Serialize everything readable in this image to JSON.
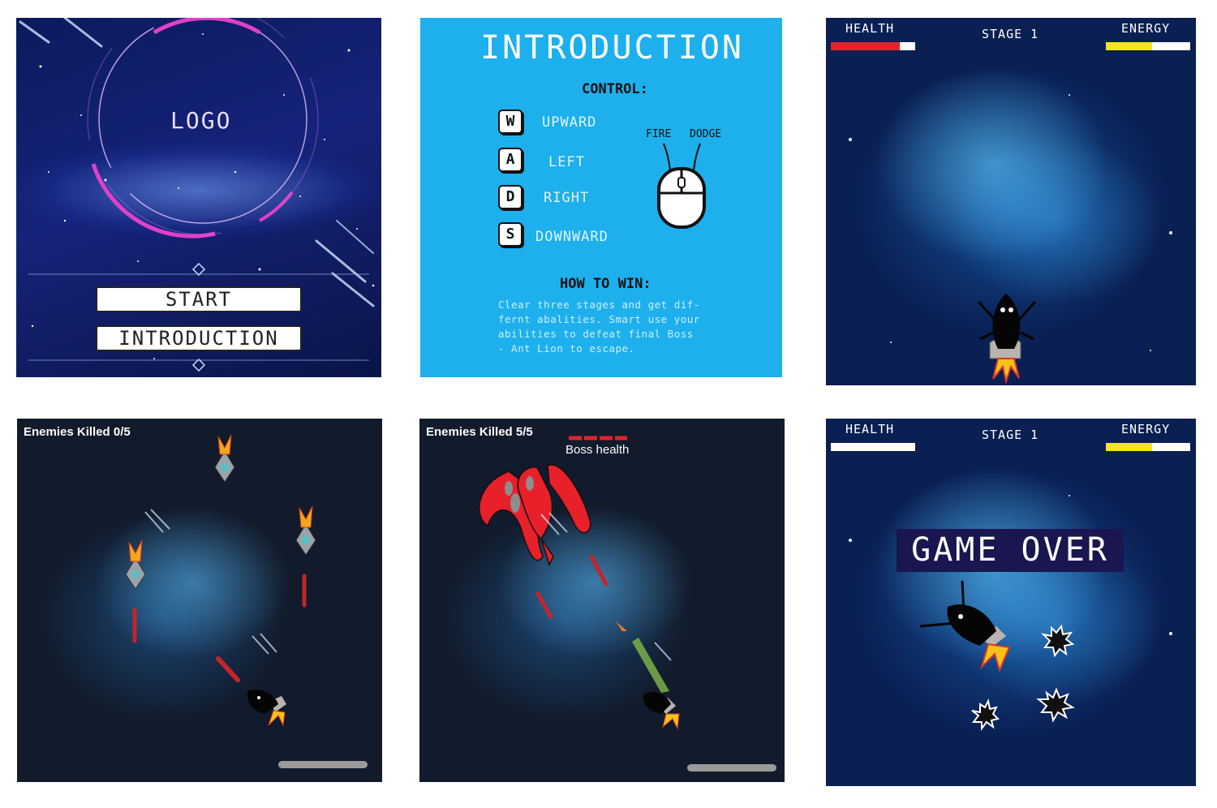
{
  "menu": {
    "logo_text": "LOGO",
    "start_label": "START",
    "introduction_label": "INTRODUCTION"
  },
  "intro": {
    "title": "INTRODUCTION",
    "control_heading": "CONTROL:",
    "keys": [
      {
        "key": "W",
        "action": "UPWARD"
      },
      {
        "key": "A",
        "action": "LEFT"
      },
      {
        "key": "D",
        "action": "RIGHT"
      },
      {
        "key": "S",
        "action": "DOWNWARD"
      }
    ],
    "mouse_fire": "FIRE",
    "mouse_dodge": "DODGE",
    "win_heading": "HOW TO WIN:",
    "win_lines": [
      "Clear three stages and get dif-",
      "fernt abalities. Smart use your",
      "abilities to defeat final Boss",
      "- Ant Lion to escape."
    ]
  },
  "hud_stage": {
    "health_label": "HEALTH",
    "stage_label": "STAGE 1",
    "energy_label": "ENERGY",
    "health_level": 0.82,
    "energy_level": 0.55
  },
  "stage_enemies": {
    "kills_text": "Enemies Killed 0/5"
  },
  "stage_boss": {
    "kills_text": "Enemies Killed 5/5",
    "boss_health_label": "Boss health"
  },
  "game_over": {
    "health_label": "HEALTH",
    "stage_label": "STAGE 1",
    "energy_label": "ENERGY",
    "health_level": 0.0,
    "energy_level": 0.55,
    "message": "GAME OVER"
  },
  "colors": {
    "intro_bg": "#1db0ec",
    "health_red": "#e5232a",
    "energy_yellow": "#f4e619",
    "boss_red": "#e8202a",
    "menu_ring_pink": "#e040c8",
    "game_over_bg": "#1a1650"
  }
}
